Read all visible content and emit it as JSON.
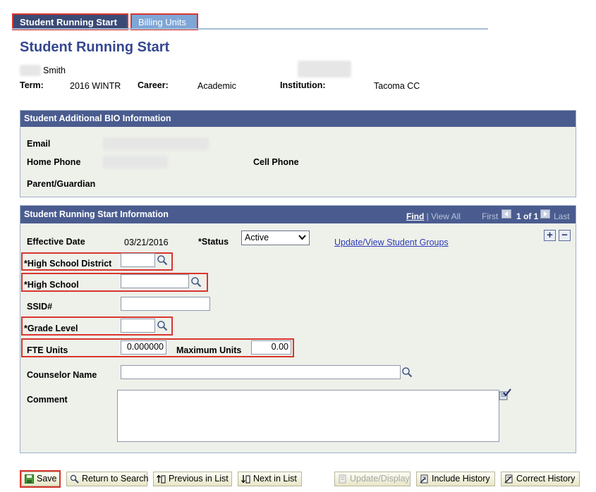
{
  "tabs": [
    {
      "label": "Student Running Start"
    },
    {
      "label": "Billing Units"
    }
  ],
  "page_title": "Student Running Start",
  "student": {
    "name_suffix": "Smith",
    "term_label": "Term:",
    "term": "2016 WINTR",
    "career_label": "Career:",
    "career": "Academic",
    "institution_label": "Institution:",
    "institution": "Tacoma CC"
  },
  "bio": {
    "header": "Student Additional BIO Information",
    "email_label": "Email",
    "home_phone_label": "Home Phone",
    "cell_phone_label": "Cell Phone",
    "parent_label": "Parent/Guardian"
  },
  "rs": {
    "header": "Student Running Start Information",
    "find_label": "Find",
    "view_all_label": "View All",
    "first_label": "First",
    "count_label": "1 of 1",
    "last_label": "Last",
    "effective_date_label": "Effective Date",
    "effective_date": "03/21/2016",
    "status_label": "*Status",
    "status_value": "Active",
    "groups_link": "Update/View Student Groups",
    "hs_district_label": "*High School District",
    "high_school_label": "*High School",
    "ssid_label": "SSID#",
    "grade_level_label": "*Grade Level",
    "fte_units_label": "FTE Units",
    "fte_units_value": "0.000000",
    "max_units_label": "Maximum Units",
    "max_units_value": "0.00",
    "counselor_label": "Counselor Name",
    "comment_label": "Comment"
  },
  "toolbar": {
    "save": "Save",
    "return_to_search": "Return to Search",
    "previous_in_list": "Previous in List",
    "next_in_list": "Next in List",
    "update_display": "Update/Display",
    "include_history": "Include History",
    "correct_history": "Correct History"
  }
}
